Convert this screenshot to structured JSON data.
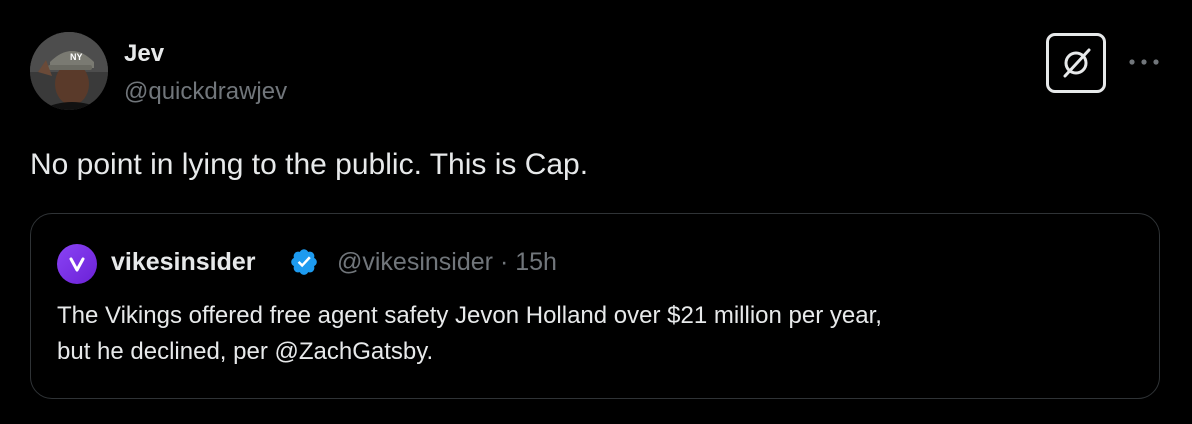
{
  "tweet": {
    "author": {
      "name": "Jev",
      "handle": "@quickdrawjev"
    },
    "text": "No point in lying to the public. This is Cap.",
    "actions": {
      "grok_icon": "grok-icon",
      "more_icon": "more-horizontal-icon"
    }
  },
  "quote": {
    "author": {
      "name": "vikesinsider",
      "verified": true,
      "handle": "@vikesinsider",
      "separator": "·",
      "time": "15h",
      "avatar_letter": "v",
      "avatar_color": "#7b2ff0"
    },
    "text_lines": [
      "The Vikings offered free agent safety Jevon Holland over $21 million per year,",
      "but he declined, per @ZachGatsby."
    ]
  },
  "colors": {
    "background": "#000000",
    "text_primary": "#e7e9ea",
    "text_secondary": "#71767b",
    "border": "#2f3336",
    "verified_blue": "#1d9bf0"
  }
}
